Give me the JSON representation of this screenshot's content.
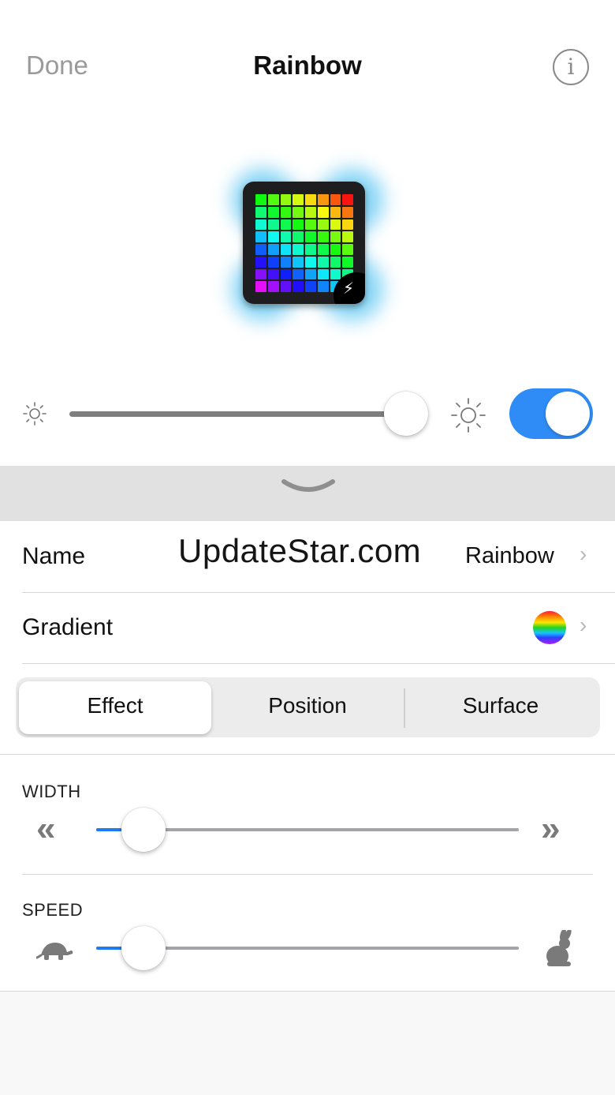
{
  "nav": {
    "done_label": "Done",
    "title": "Rainbow",
    "info_icon": "i"
  },
  "hero": {
    "device_icon": "rainbow-panel-icon",
    "badge_icon": "lightning-bolt-icon"
  },
  "brightness": {
    "level": 0.93,
    "power_on": true,
    "accent": "#2f8bf5"
  },
  "watermark": "UpdateStar.com",
  "rows": {
    "name_label": "Name",
    "name_value": "Rainbow",
    "gradient_label": "Gradient",
    "chevron": "›"
  },
  "tabs": {
    "items": [
      "Effect",
      "Position",
      "Surface"
    ],
    "selected": "Effect"
  },
  "width_slider": {
    "label": "WIDTH",
    "left_glyph": "«",
    "right_glyph": "»",
    "level": 0.11
  },
  "speed_slider": {
    "label": "SPEED",
    "left_icon": "turtle-icon",
    "right_icon": "rabbit-icon",
    "level": 0.11
  }
}
